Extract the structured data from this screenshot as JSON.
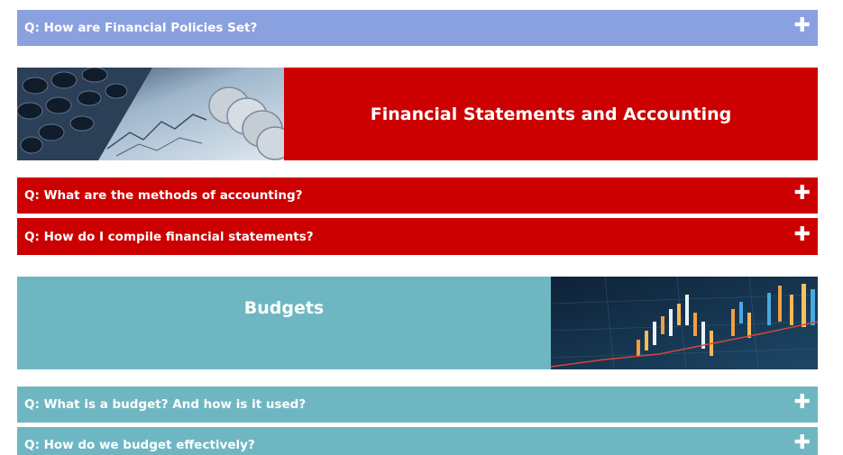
{
  "sections": [
    {
      "question": "Q: How are Financial Policies Set?",
      "toggle": "✚"
    },
    {
      "banner_title": "Financial Statements and Accounting"
    },
    {
      "question": "Q: What are the methods of accounting?",
      "toggle": "✚"
    },
    {
      "question": "Q: How do I compile financial statements?",
      "toggle": "✚"
    },
    {
      "banner_title": "Budgets"
    },
    {
      "question": "Q: What is a budget? And how is it used?",
      "toggle": "✚"
    },
    {
      "question": "Q: How do we budget effectively?",
      "toggle": "✚"
    }
  ],
  "colors": {
    "blue": "#8aa1e0",
    "red": "#cc0000",
    "teal": "#6eb7c2"
  }
}
